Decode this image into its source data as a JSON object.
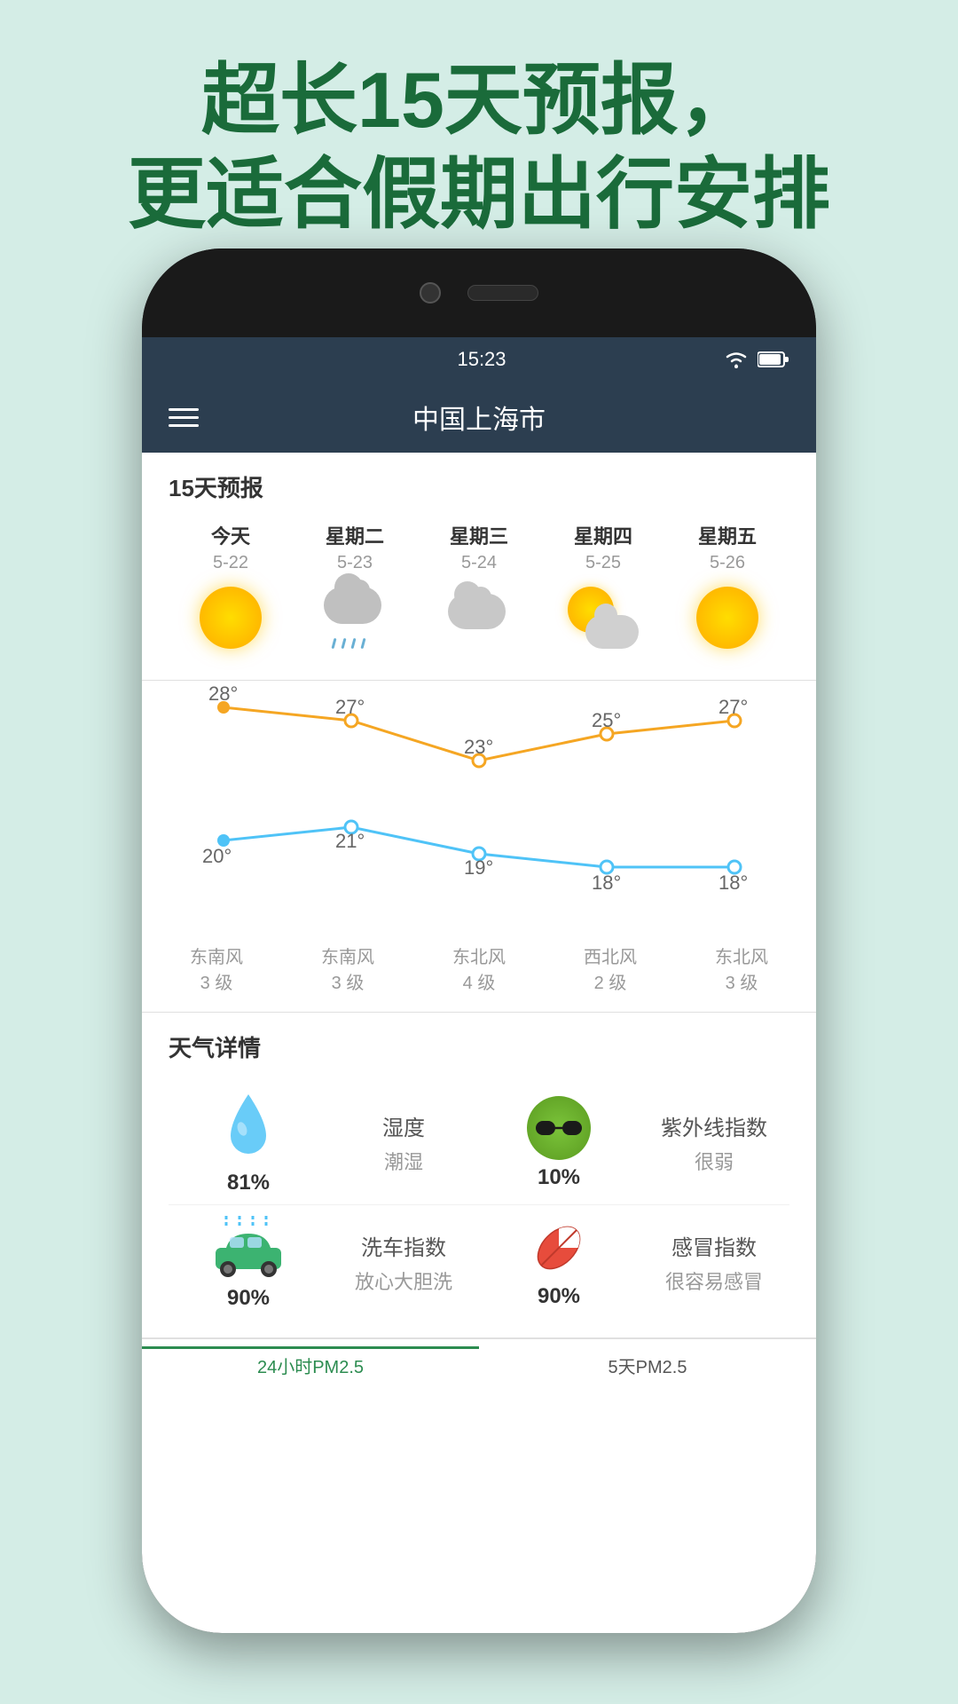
{
  "page": {
    "background_color": "#d4ede6",
    "header_line1": "超长15天预报，",
    "header_line2": "更适合假期出行安排"
  },
  "status_bar": {
    "time": "15:23",
    "wifi_icon": "wifi",
    "battery_icon": "battery"
  },
  "app_bar": {
    "title": "中国上海市",
    "menu_icon": "menu"
  },
  "forecast": {
    "section_title": "15天预报",
    "days": [
      {
        "name": "今天",
        "date": "5-22",
        "icon": "sun",
        "high": "28°",
        "low": "20°",
        "wind_dir": "东南风",
        "wind_level": "3 级"
      },
      {
        "name": "星期二",
        "date": "5-23",
        "icon": "cloud-rain",
        "high": "27°",
        "low": "21°",
        "wind_dir": "东南风",
        "wind_level": "3 级"
      },
      {
        "name": "星期三",
        "date": "5-24",
        "icon": "cloud",
        "high": "23°",
        "low": "19°",
        "wind_dir": "东北风",
        "wind_level": "4 级"
      },
      {
        "name": "星期四",
        "date": "5-25",
        "icon": "partly-cloudy",
        "high": "25°",
        "low": "18°",
        "wind_dir": "西北风",
        "wind_level": "2 级"
      },
      {
        "name": "星期五",
        "date": "5-26",
        "icon": "sun",
        "high": "27°",
        "low": "18°",
        "wind_dir": "东北风",
        "wind_level": "3 级"
      }
    ],
    "chart": {
      "high_temps": [
        28,
        27,
        23,
        25,
        27
      ],
      "low_temps": [
        20,
        21,
        19,
        18,
        18
      ],
      "high_color": "#f5a623",
      "low_color": "#4fc3f7"
    }
  },
  "details": {
    "section_title": "天气详情",
    "items": [
      {
        "icon": "water-drop",
        "value": "81%",
        "label": "",
        "sublabel": ""
      },
      {
        "label": "湿度",
        "sublabel": "潮湿"
      },
      {
        "icon": "sunglasses-face",
        "value": "10%",
        "label": "",
        "sublabel": ""
      },
      {
        "label": "紫外线指数",
        "sublabel": "很弱"
      },
      {
        "icon": "car-wash",
        "value": "90%",
        "label": "",
        "sublabel": ""
      },
      {
        "label": "洗车指数",
        "sublabel": "放心大胆洗"
      },
      {
        "icon": "pill",
        "value": "90%",
        "label": "",
        "sublabel": ""
      },
      {
        "label": "感冒指数",
        "sublabel": "很容易感冒"
      }
    ]
  },
  "bottom_tabs": [
    {
      "label": "24小时PM2.5",
      "active": true
    },
    {
      "label": "5天PM2.5",
      "active": false
    }
  ]
}
